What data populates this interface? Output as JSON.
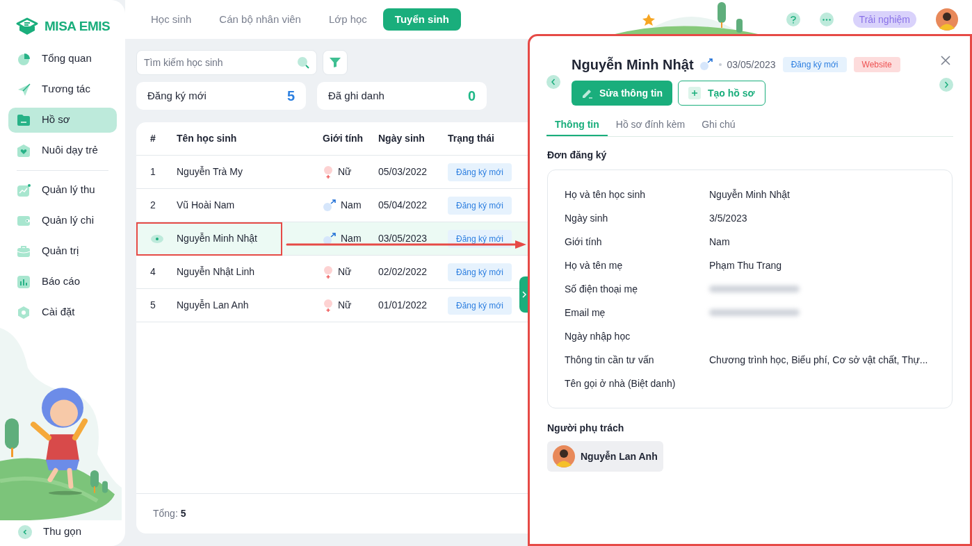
{
  "app": {
    "logo": "MISA EMIS"
  },
  "sidebar": {
    "items": [
      {
        "label": "Tổng quan",
        "selected": false
      },
      {
        "label": "Tương tác",
        "selected": false
      },
      {
        "label": "Hồ sơ",
        "selected": true
      },
      {
        "label": "Nuôi dạy trẻ",
        "selected": false,
        "divider_after": true
      },
      {
        "label": "Quản lý thu",
        "selected": false
      },
      {
        "label": "Quản lý chi",
        "selected": false
      },
      {
        "label": "Quản trị",
        "selected": false
      },
      {
        "label": "Báo cáo",
        "selected": false
      },
      {
        "label": "Cài đặt",
        "selected": false
      }
    ],
    "collapse": "Thu gọn"
  },
  "top_tabs": [
    {
      "label": "Học sinh",
      "selected": false
    },
    {
      "label": "Cán bộ nhân viên",
      "selected": false
    },
    {
      "label": "Lớp học",
      "selected": false
    },
    {
      "label": "Tuyển sinh",
      "selected": true
    }
  ],
  "header": {
    "trial": "Trải nghiệm"
  },
  "search": {
    "placeholder": "Tìm kiếm học sinh"
  },
  "stats": [
    {
      "label": "Đăng ký mới",
      "value": "5",
      "color": "#2b7fe0"
    },
    {
      "label": "Đã ghi danh",
      "value": "0",
      "color": "#1fb887"
    }
  ],
  "table": {
    "columns": [
      "#",
      "Tên học sinh",
      "Giới tính",
      "Ngày sinh",
      "Trạng thái"
    ],
    "rows": [
      {
        "number": "1",
        "name": "Nguyễn Trà My",
        "gender": "Nữ",
        "kind": "female",
        "birth": "05/03/2022",
        "status": "Đăng ký mới",
        "selected": false,
        "highlighted": false
      },
      {
        "number": "2",
        "name": "Vũ Hoài Nam",
        "gender": "Nam",
        "kind": "male",
        "birth": "05/04/2022",
        "status": "Đăng ký mới",
        "selected": false,
        "highlighted": false
      },
      {
        "name": "Nguyễn Minh Nhật",
        "gender": "Nam",
        "kind": "male",
        "birth": "03/05/2023",
        "status": "Đăng ký mới",
        "selected": true,
        "highlighted": true
      },
      {
        "number": "4",
        "name": "Nguyễn Nhật Linh",
        "gender": "Nữ",
        "kind": "female",
        "birth": "02/02/2022",
        "status": "Đăng ký mới",
        "selected": false,
        "highlighted": false
      },
      {
        "number": "5",
        "name": "Nguyễn Lan Anh",
        "gender": "Nữ",
        "kind": "female",
        "birth": "01/01/2022",
        "status": "Đăng ký mới",
        "selected": false,
        "highlighted": false
      }
    ],
    "total_label": "Tổng:",
    "total": "5"
  },
  "detail": {
    "highlighted": true,
    "name": "Nguyễn Minh Nhật",
    "gender_mark": {
      "kind": "male"
    },
    "birth": "03/05/2023",
    "badges": [
      {
        "label": "Đăng ký mới",
        "kind": "status"
      },
      {
        "label": "Website",
        "kind": "source"
      }
    ],
    "buttons": [
      {
        "label": "Sửa thông tin",
        "kind": "primary"
      },
      {
        "label": "Tạo hồ sơ",
        "kind": "secondary"
      }
    ],
    "tabs": [
      {
        "label": "Thông tin",
        "selected": true
      },
      {
        "label": "Hồ sơ đính kèm",
        "selected": false
      },
      {
        "label": "Ghi chú",
        "selected": false
      }
    ],
    "section": "Đơn đăng ký",
    "fields": [
      {
        "label": "Họ và tên học sinh",
        "value": "Nguyễn Minh Nhật"
      },
      {
        "label": "Ngày sinh",
        "value": "3/5/2023"
      },
      {
        "label": "Giới tính",
        "value": "Nam"
      },
      {
        "label": "Họ và tên mẹ",
        "value": "Phạm Thu Trang"
      },
      {
        "label": "Số điện thoại mẹ",
        "blurred": true
      },
      {
        "label": "Email mẹ",
        "blurred": true
      },
      {
        "label": "Ngày nhập học"
      },
      {
        "label": "Thông tin cần tư vấn",
        "value": "Chương trình học, Biểu phí, Cơ sở vật chất, Thự..."
      },
      {
        "label": "Tên gọi ở nhà (Biệt danh)"
      }
    ],
    "owner_title": "Người phụ trách",
    "owner": "Nguyễn Lan Anh"
  }
}
